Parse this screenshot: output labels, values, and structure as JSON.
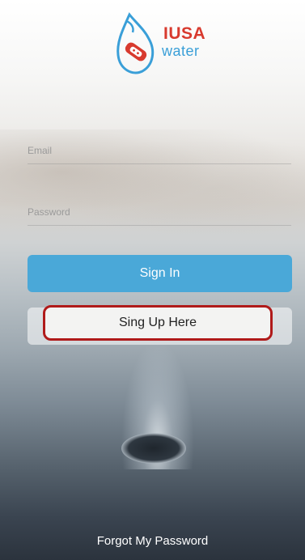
{
  "logo": {
    "brand_top": "IUSA",
    "brand_bottom": "water",
    "icon": "water-drop-icon"
  },
  "form": {
    "email_placeholder": "Email",
    "password_placeholder": "Password"
  },
  "actions": {
    "signin_label": "Sign In",
    "signup_label": "Sing Up Here",
    "forgot_label": "Forgot My Password"
  },
  "colors": {
    "signin_button": "#4aa8d8",
    "highlight_border": "#b01a1a",
    "brand_red": "#d83a2e",
    "brand_blue": "#3a9fd8"
  }
}
